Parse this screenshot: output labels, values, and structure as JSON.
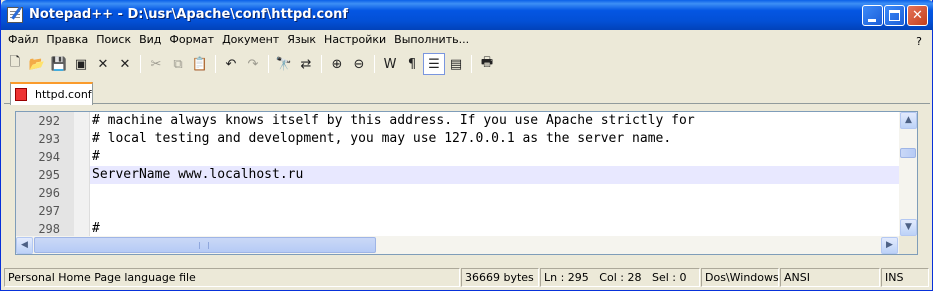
{
  "window": {
    "title": "Notepad++ - D:\\usr\\Apache\\conf\\httpd.conf"
  },
  "menu": {
    "items": [
      "Файл",
      "Правка",
      "Поиск",
      "Вид",
      "Формат",
      "Документ",
      "Язык",
      "Настройки",
      "Выполнить..."
    ],
    "help": "?"
  },
  "toolbar": {
    "buttons": [
      "new-icon",
      "open-icon",
      "save-icon",
      "save-all-icon",
      "close-icon",
      "close-all-icon",
      "cut-icon",
      "copy-icon",
      "paste-icon",
      "undo-icon",
      "redo-icon",
      "find-icon",
      "replace-icon",
      "zoom-in-icon",
      "zoom-out-icon",
      "word-wrap-icon",
      "show-all-chars-icon",
      "indent-guide-icon",
      "user-lang-icon",
      "print-icon"
    ]
  },
  "tab": {
    "label": "httpd.conf"
  },
  "editor": {
    "lines": [
      {
        "num": "292",
        "text": "# machine always knows itself by this address. If you use Apache strictly for"
      },
      {
        "num": "293",
        "text": "# local testing and development, you may use 127.0.0.1 as the server name."
      },
      {
        "num": "294",
        "text": "#"
      },
      {
        "num": "295",
        "text": "ServerName www.localhost.ru"
      },
      {
        "num": "296",
        "text": ""
      },
      {
        "num": "297",
        "text": ""
      },
      {
        "num": "298",
        "text": "#"
      }
    ],
    "current_line": "295"
  },
  "status": {
    "filetype": "Personal Home Page language file",
    "size": "36669 bytes",
    "ln": "Ln : 295",
    "col": "Col : 28",
    "sel": "Sel : 0",
    "eol": "Dos\\Windows",
    "encoding": "ANSI",
    "mode": "INS"
  }
}
